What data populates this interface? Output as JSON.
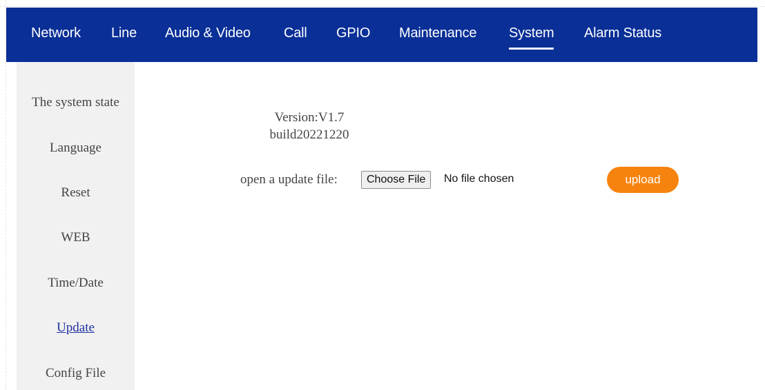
{
  "nav": {
    "items": [
      {
        "label": "Network"
      },
      {
        "label": "Line"
      },
      {
        "label": "Audio & Video"
      },
      {
        "label": "Call"
      },
      {
        "label": "GPIO"
      },
      {
        "label": "Maintenance"
      },
      {
        "label": "System",
        "active": true
      },
      {
        "label": "Alarm Status"
      }
    ]
  },
  "sidebar": {
    "items": [
      {
        "label": "The system state"
      },
      {
        "label": "Language"
      },
      {
        "label": "Reset"
      },
      {
        "label": "WEB"
      },
      {
        "label": "Time/Date"
      },
      {
        "label": "Update",
        "active": true
      },
      {
        "label": "Config File"
      }
    ]
  },
  "main": {
    "version_line": "Version:V1.7",
    "build_line": "build20221220",
    "file_label": "open a update file:",
    "choose_file_button": "Choose File",
    "file_status": "No file chosen",
    "upload_button": "upload"
  },
  "colors": {
    "nav_background": "#0a2f97",
    "upload_button": "#f7830f",
    "sidebar_background": "#f1f1f1"
  }
}
